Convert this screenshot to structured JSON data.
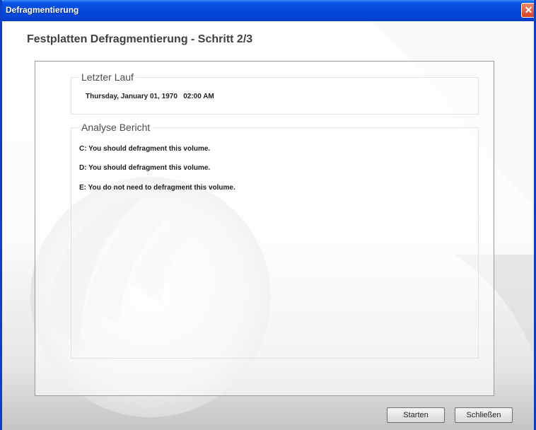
{
  "window": {
    "title": "Defragmentierung",
    "close_glyph": "✕"
  },
  "page": {
    "heading": "Festplatten Defragmentierung - Schritt 2/3"
  },
  "last_run": {
    "legend": "Letzter Lauf",
    "value": "Thursday, January 01, 1970   02:00 AM"
  },
  "analysis": {
    "legend": "Analyse Bericht",
    "lines": [
      "C: You should defragment this volume.",
      "D: You should defragment this volume.",
      "E: You do not need to defragment this volume."
    ]
  },
  "buttons": {
    "start_label": "Starten",
    "close_label": "Schließen"
  },
  "colors": {
    "titlebar": "#0449dd",
    "window_border": "#0a3fc8",
    "close_button": "#d8411f"
  }
}
